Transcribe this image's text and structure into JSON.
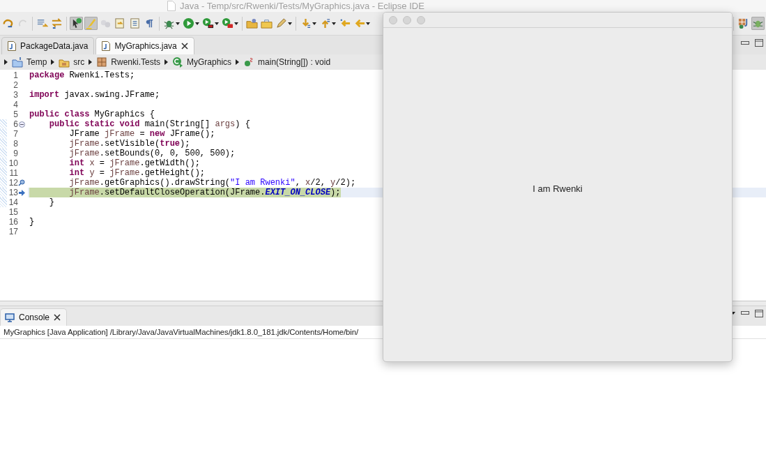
{
  "window": {
    "title": "Java - Temp/src/Rwenki/Tests/MyGraphics.java - Eclipse IDE"
  },
  "editor_tabs": [
    {
      "label": "PackageData.java",
      "selected": false
    },
    {
      "label": "MyGraphics.java",
      "selected": true
    }
  ],
  "breadcrumb": [
    {
      "label": "Temp",
      "kind": "project"
    },
    {
      "label": "src",
      "kind": "source-folder"
    },
    {
      "label": "Rwenki.Tests",
      "kind": "package"
    },
    {
      "label": "MyGraphics",
      "kind": "class"
    },
    {
      "label": "main(String[]) : void",
      "kind": "method"
    }
  ],
  "code_lines": [
    {
      "number": "1",
      "collapsible": false,
      "annotated": false,
      "in_scope": false,
      "selected": false,
      "tokens": [
        {
          "kind": "keyword",
          "text": "package"
        },
        {
          "kind": "plain",
          "text": " Rwenki.Tests;"
        }
      ]
    },
    {
      "number": "2",
      "collapsible": false,
      "annotated": false,
      "in_scope": false,
      "selected": false
    },
    {
      "number": "3",
      "collapsible": false,
      "annotated": false,
      "in_scope": false,
      "selected": false,
      "tokens": [
        {
          "kind": "keyword",
          "text": "import"
        },
        {
          "kind": "plain",
          "text": " javax.swing.JFrame;"
        }
      ]
    },
    {
      "number": "4",
      "collapsible": false,
      "annotated": false,
      "in_scope": false,
      "selected": false
    },
    {
      "number": "5",
      "collapsible": false,
      "annotated": false,
      "in_scope": false,
      "selected": false,
      "tokens": [
        {
          "kind": "keyword",
          "text": "public class"
        },
        {
          "kind": "plain",
          "text": " MyGraphics {"
        }
      ]
    },
    {
      "number": "6",
      "collapsible": true,
      "annotated": false,
      "in_scope": true,
      "selected": false,
      "tokens": [
        {
          "kind": "keyword",
          "text": "    public static void"
        },
        {
          "kind": "plain",
          "text": " main(String[] "
        },
        {
          "kind": "variable",
          "text": "args"
        },
        {
          "kind": "plain",
          "text": ") {"
        }
      ]
    },
    {
      "number": "7",
      "collapsible": false,
      "annotated": false,
      "in_scope": true,
      "selected": false,
      "tokens": [
        {
          "kind": "plain",
          "text": "        JFrame "
        },
        {
          "kind": "variable",
          "text": "jFrame"
        },
        {
          "kind": "plain",
          "text": " = "
        },
        {
          "kind": "keyword",
          "text": "new"
        },
        {
          "kind": "plain",
          "text": " JFrame();"
        }
      ]
    },
    {
      "number": "8",
      "collapsible": false,
      "annotated": false,
      "in_scope": true,
      "selected": false,
      "tokens": [
        {
          "kind": "variable",
          "text": "        jFrame"
        },
        {
          "kind": "plain",
          "text": ".setVisible("
        },
        {
          "kind": "keyword",
          "text": "true"
        },
        {
          "kind": "plain",
          "text": ");"
        }
      ]
    },
    {
      "number": "9",
      "collapsible": false,
      "annotated": false,
      "in_scope": true,
      "selected": false,
      "tokens": [
        {
          "kind": "variable",
          "text": "        jFrame"
        },
        {
          "kind": "plain",
          "text": ".setBounds(0, 0, 500, 500);"
        }
      ]
    },
    {
      "number": "10",
      "collapsible": false,
      "annotated": false,
      "in_scope": true,
      "selected": false,
      "tokens": [
        {
          "kind": "keyword",
          "text": "        int"
        },
        {
          "kind": "variable",
          "text": " x"
        },
        {
          "kind": "plain",
          "text": " = "
        },
        {
          "kind": "variable",
          "text": "jFrame"
        },
        {
          "kind": "plain",
          "text": ".getWidth();"
        }
      ]
    },
    {
      "number": "11",
      "collapsible": false,
      "annotated": false,
      "in_scope": true,
      "selected": false,
      "tokens": [
        {
          "kind": "keyword",
          "text": "        int"
        },
        {
          "kind": "variable",
          "text": " y"
        },
        {
          "kind": "plain",
          "text": " = "
        },
        {
          "kind": "variable",
          "text": "jFrame"
        },
        {
          "kind": "plain",
          "text": ".getHeight();"
        }
      ]
    },
    {
      "number": "12",
      "collapsible": false,
      "annotated": true,
      "in_scope": true,
      "selected": false,
      "tokens": [
        {
          "kind": "variable",
          "text": "        jFrame"
        },
        {
          "kind": "plain",
          "text": ".getGraphics().drawString("
        },
        {
          "kind": "string",
          "text": "\"I am Rwenki\""
        },
        {
          "kind": "plain",
          "text": ", "
        },
        {
          "kind": "variable",
          "text": "x"
        },
        {
          "kind": "plain",
          "text": "/2, "
        },
        {
          "kind": "variable",
          "text": "y"
        },
        {
          "kind": "plain",
          "text": "/2);"
        }
      ]
    },
    {
      "number": "13",
      "collapsible": false,
      "annotated": false,
      "in_scope": true,
      "selected": true,
      "tokens": [
        {
          "kind": "variable",
          "text": "        jFrame"
        },
        {
          "kind": "plain",
          "text": ".setDefaultCloseOperation(JFrame."
        },
        {
          "kind": "constant",
          "text": "EXIT_ON_CLOSE"
        },
        {
          "kind": "plain",
          "text": ");"
        }
      ]
    },
    {
      "number": "14",
      "collapsible": false,
      "annotated": false,
      "in_scope": true,
      "selected": false,
      "tokens": [
        {
          "kind": "plain",
          "text": "    }"
        }
      ]
    },
    {
      "number": "15",
      "collapsible": false,
      "annotated": false,
      "in_scope": false,
      "selected": false
    },
    {
      "number": "16",
      "collapsible": false,
      "annotated": false,
      "in_scope": false,
      "selected": false,
      "tokens": [
        {
          "kind": "plain",
          "text": "}"
        }
      ]
    },
    {
      "number": "17",
      "collapsible": false,
      "annotated": false,
      "in_scope": false,
      "selected": false
    }
  ],
  "console": {
    "tab": "Console",
    "line": "MyGraphics [Java Application] /Library/Java/JavaVirtualMachines/jdk1.8.0_181.jdk/Contents/Home/bin/"
  },
  "frame": {
    "message": "I am Rwenki"
  }
}
